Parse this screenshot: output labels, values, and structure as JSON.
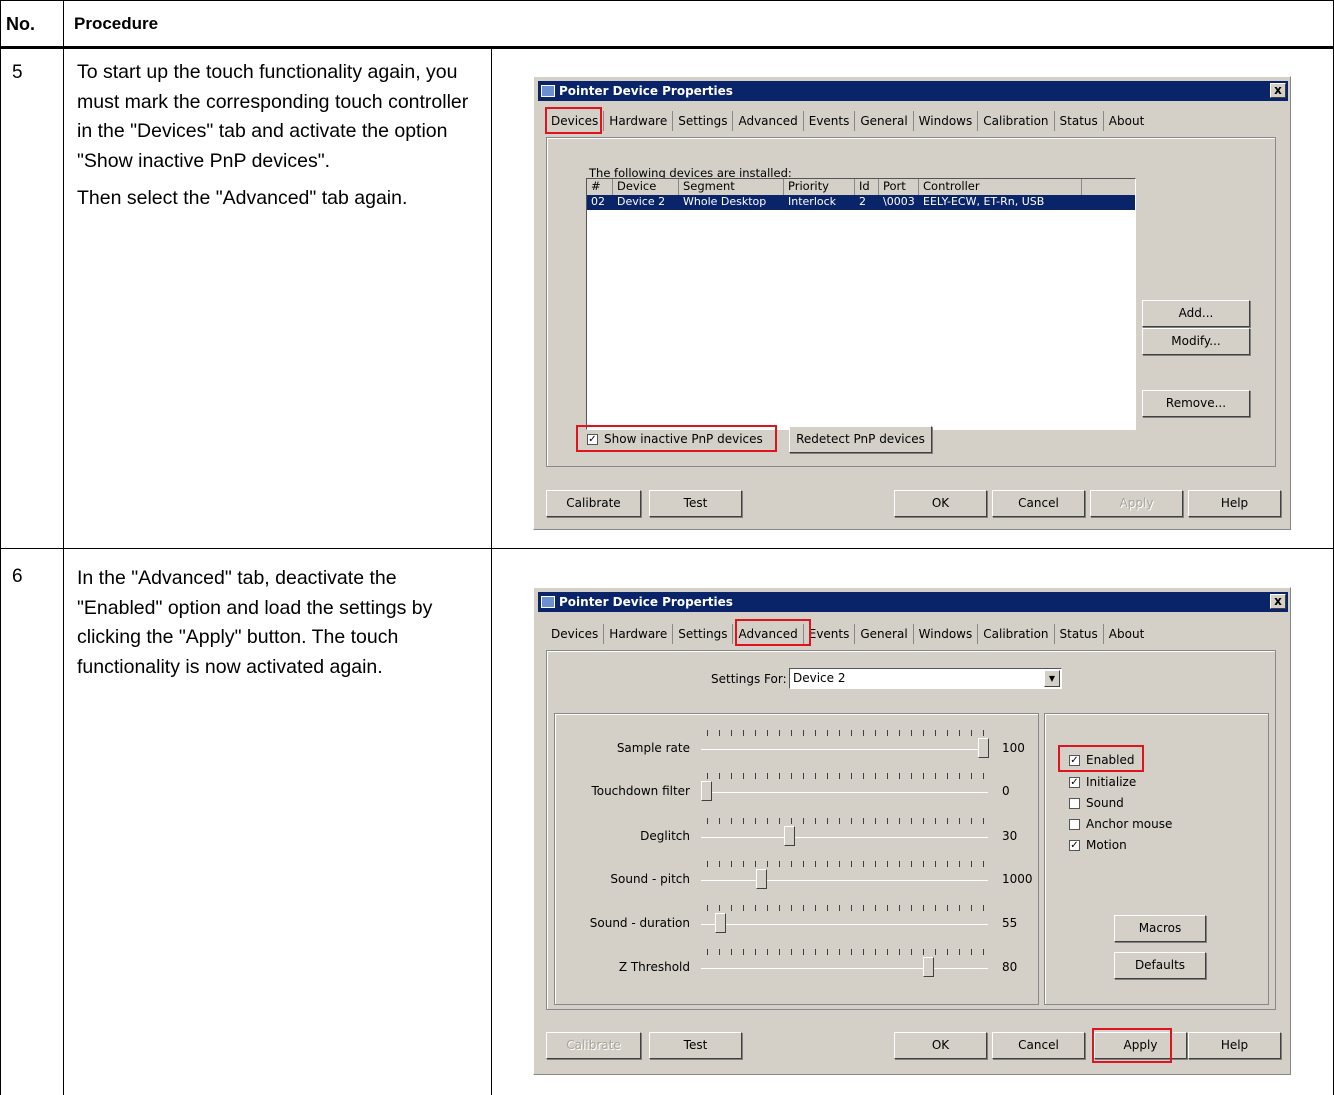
{
  "table": {
    "header": {
      "no": "No.",
      "procedure": "Procedure"
    },
    "rows": [
      {
        "no": "5",
        "text": [
          "To start up the touch functionality again, you must mark the corresponding touch controller in the \"Devices\" tab and activate the option \"Show inactive PnP devices\".",
          "Then select the \"Advanced\" tab again."
        ]
      },
      {
        "no": "6",
        "text": [
          "In the \"Advanced\" tab, deactivate the \"Enabled\" option and load the settings by clicking the \"Apply\" button. The touch functionality is now activated again."
        ]
      }
    ]
  },
  "dialog": {
    "title": "Pointer Device Properties",
    "close": "x",
    "tabs": [
      "Devices",
      "Hardware",
      "Settings",
      "Advanced",
      "Events",
      "General",
      "Windows",
      "Calibration",
      "Status",
      "About"
    ],
    "footer": {
      "calibrate": "Calibrate",
      "test": "Test",
      "ok": "OK",
      "cancel": "Cancel",
      "apply": "Apply",
      "help": "Help"
    }
  },
  "devices_tab": {
    "installed_label": "The following devices are installed:",
    "columns": [
      "#",
      "Device",
      "Segment",
      "Priority",
      "Id",
      "Port",
      "Controller"
    ],
    "row": [
      "02",
      "Device 2",
      "Whole Desktop",
      "Interlock",
      "2",
      "\\0003",
      "EELY-ECW, ET-Rn, USB"
    ],
    "buttons": {
      "add": "Add...",
      "modify": "Modify...",
      "remove": "Remove..."
    },
    "show_inactive": {
      "label": "Show inactive PnP devices",
      "checked": true
    },
    "redetect": "Redetect PnP devices"
  },
  "advanced_tab": {
    "settings_for_label": "Settings For:",
    "settings_for_value": "Device 2",
    "sliders": [
      {
        "label": "Sample rate",
        "value": "100",
        "level": 1.0
      },
      {
        "label": "Touchdown filter",
        "value": "0",
        "level": 0.0
      },
      {
        "label": "Deglitch",
        "value": "30",
        "level": 0.3
      },
      {
        "label": "Sound - pitch",
        "value": "1000",
        "level": 0.2
      },
      {
        "label": "Sound - duration",
        "value": "55",
        "level": 0.05
      },
      {
        "label": "Z Threshold",
        "value": "80",
        "level": 0.8
      }
    ],
    "options": [
      {
        "label": "Enabled",
        "checked": true
      },
      {
        "label": "Initialize",
        "checked": true
      },
      {
        "label": "Sound",
        "checked": false
      },
      {
        "label": "Anchor mouse",
        "checked": false
      },
      {
        "label": "Motion",
        "checked": true
      }
    ],
    "buttons": {
      "macros": "Macros",
      "defaults": "Defaults"
    }
  },
  "colors": {
    "highlight": "#e0141e",
    "dialog_bg": "#d4d0c8",
    "title_bar": "#0a246a"
  }
}
